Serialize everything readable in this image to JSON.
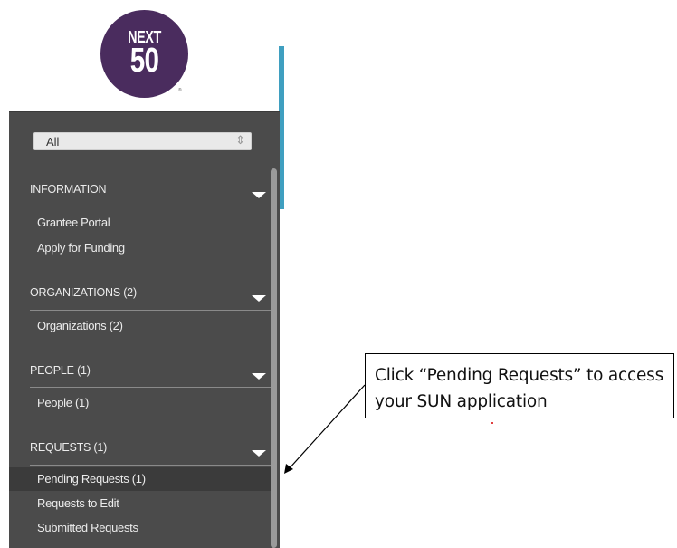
{
  "logo": {
    "line1": "NEXT",
    "line2": "50",
    "mark": "®",
    "color": "#4a2c5e"
  },
  "filter": {
    "value": "All"
  },
  "sidebar": {
    "sections": [
      {
        "title": "INFORMATION",
        "items": [
          "Grantee Portal",
          "Apply for Funding"
        ]
      },
      {
        "title": "ORGANIZATIONS (2)",
        "items": [
          "Organizations  (2)"
        ]
      },
      {
        "title": "PEOPLE (1)",
        "items": [
          "People  (1)"
        ]
      },
      {
        "title": "REQUESTS (1)",
        "items": [
          "Pending Requests  (1)",
          "Requests to Edit",
          "Submitted Requests"
        ]
      }
    ],
    "active_item": "Pending Requests  (1)"
  },
  "callout": {
    "text": "Click “Pending Requests” to access your SUN application"
  },
  "colors": {
    "sidebar_bg": "#4b4b4b",
    "accent": "#3f9fc0"
  }
}
